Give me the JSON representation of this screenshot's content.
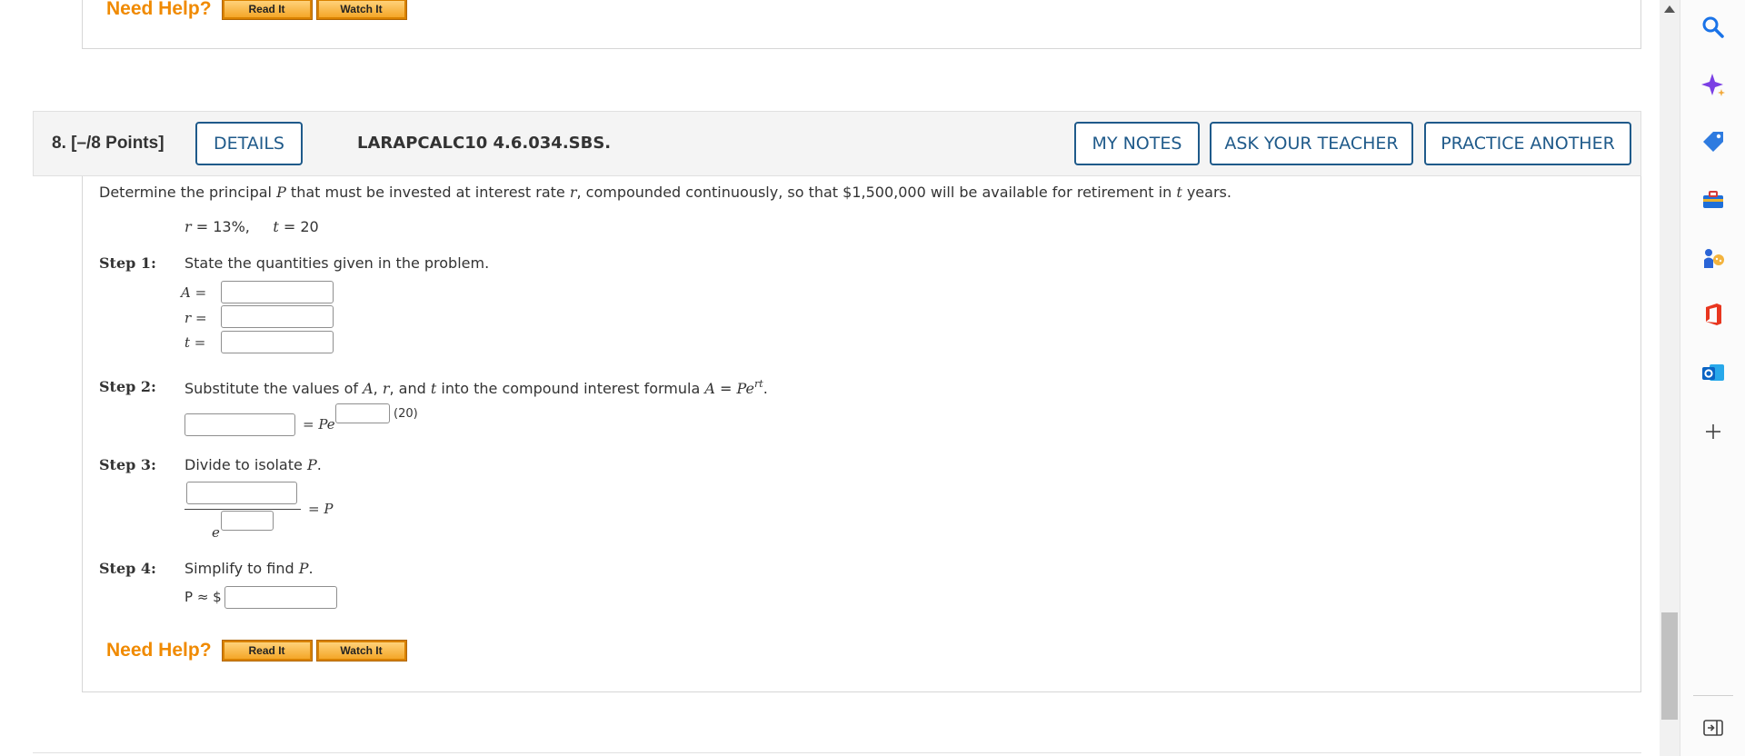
{
  "prev_question": {
    "need_help": "Need Help?",
    "read_it": "Read It",
    "watch_it": "Watch It"
  },
  "question": {
    "number": "8.  [–/8 Points]",
    "details_button": "DETAILS",
    "code": "LARAPCALC10 4.6.034.SBS.",
    "my_notes_button": "MY NOTES",
    "ask_teacher_button": "ASK YOUR TEACHER",
    "practice_another_button": "PRACTICE ANOTHER",
    "prompt_a": "Determine the principal ",
    "prompt_P": "P",
    "prompt_b": " that must be invested at interest rate ",
    "prompt_r": "r",
    "prompt_c": ", compounded continuously, so that $1,500,000 will be available for retirement in ",
    "prompt_t": "t",
    "prompt_d": " years.",
    "given_r_var": "r",
    "given_r_val": " = 13%,",
    "given_t_var": "t",
    "given_t_val": " = 20",
    "step1": {
      "label": "Step 1:",
      "text": "State the quantities given in the problem.",
      "A_label": "A  =",
      "r_label": "r  =",
      "t_label": "t  ="
    },
    "step2": {
      "label": "Step 2:",
      "text_a": "Substitute the values of ",
      "A": "A",
      "sep1": ", ",
      "r": "r",
      "sep2": ", and ",
      "t": "t",
      "text_b": " into the compound interest formula ",
      "formula_A": "A",
      "formula_eq": " = ",
      "formula_Pe": "Pe",
      "formula_sup": "rt",
      "formula_end": ".",
      "eq_Pe": "= Pe",
      "exp_tail": "(20)"
    },
    "step3": {
      "label": "Step 3:",
      "text_a": "Divide to isolate ",
      "P": "P",
      "text_end": ".",
      "denominator_e": "e",
      "eq_P": "= P"
    },
    "step4": {
      "label": "Step 4:",
      "text_a": "Simplify to find ",
      "P": "P",
      "text_end": ".",
      "approx_label": "P ≈ $"
    },
    "need_help": "Need Help?",
    "read_it": "Read It",
    "watch_it": "Watch It"
  },
  "sidebar_icons": [
    "search-icon",
    "copilot-sparkle-icon",
    "shopping-tag-icon",
    "toolbox-icon",
    "games-icon",
    "office-icon",
    "outlook-icon",
    "add-icon",
    "collapse-sidebar-icon"
  ],
  "colors": {
    "accent_blue": "#1f5a8a",
    "need_help_orange": "#f08a00",
    "help_button_gold": "#f4a628"
  }
}
